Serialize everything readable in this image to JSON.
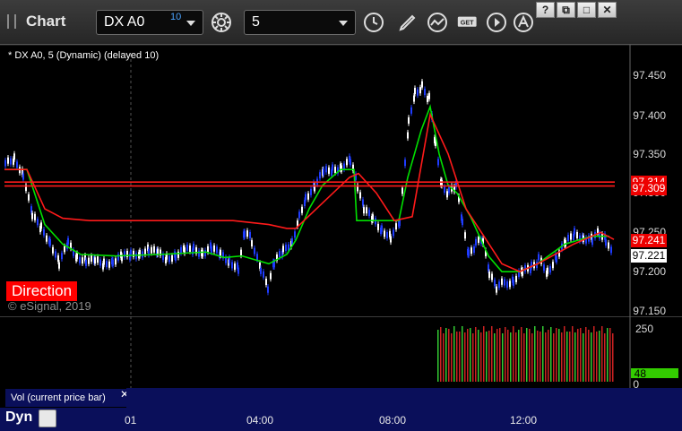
{
  "toolbar": {
    "app_title": "Chart",
    "symbol": "DX A0",
    "delay_badge": "10",
    "interval": "5",
    "window_buttons": [
      "?",
      "⧉",
      "□",
      "✕"
    ]
  },
  "chart": {
    "caption": "* DX A0, 5 (Dynamic) (delayed 10)",
    "direction_label": "Direction",
    "watermark": "© eSignal, 2019",
    "price_axis": [
      "97.450",
      "97.400",
      "97.350",
      "97.300",
      "97.250",
      "97.200",
      "97.150"
    ],
    "tags": {
      "upper_red": "97.314",
      "upper_red2": "97.309",
      "mid_red": "97.241",
      "last": "97.221"
    },
    "colors": {
      "up_bar": "#ffffff",
      "down_bar": "#1f3cff",
      "fast_line": "#00e000",
      "slow_line": "#ff1a1a",
      "background": "#000000"
    }
  },
  "volume": {
    "panel_label": "Vol (current price bar)",
    "axis": [
      "250",
      "0"
    ],
    "current_value": "48"
  },
  "time_axis": {
    "mode": "Dyn",
    "labels": [
      "01",
      "04:00",
      "08:00",
      "12:00"
    ]
  },
  "chart_data": {
    "type": "candlestick",
    "ylim": [
      97.15,
      97.46
    ],
    "series": [
      {
        "name": "Vol (current price bar)",
        "values": [
          48
        ]
      }
    ]
  }
}
